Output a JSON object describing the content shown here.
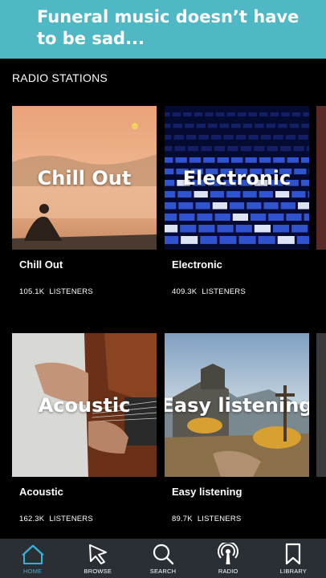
{
  "banner": {
    "text": "Funeral music doesn’t have to be sad..."
  },
  "section": {
    "title": "RADIO STATIONS"
  },
  "stations": [
    {
      "overlay": "Chill Out",
      "name": "Chill Out",
      "count": "105.1K",
      "listeners_label": "LISTENERS"
    },
    {
      "overlay": "Electronic",
      "name": "Electronic",
      "count": "409.3K",
      "listeners_label": "LISTENERS"
    },
    {
      "overlay": "Acoustic",
      "name": "Acoustic",
      "count": "162.3K",
      "listeners_label": "LISTENERS"
    },
    {
      "overlay": "Easy listening",
      "name": "Easy listening",
      "count": "89.7K",
      "listeners_label": "LISTENERS"
    }
  ],
  "nav": {
    "items": [
      {
        "label": "HOME",
        "icon": "home-icon",
        "active": true
      },
      {
        "label": "BROWSE",
        "icon": "cursor-icon"
      },
      {
        "label": "SEARCH",
        "icon": "search-icon"
      },
      {
        "label": "RADIO",
        "icon": "radio-icon"
      },
      {
        "label": "LIBRARY",
        "icon": "bookmark-icon"
      }
    ]
  },
  "colors": {
    "banner": "#4fb8c4",
    "nav_bg": "#2a2f36",
    "active": "#3ab0d8"
  }
}
